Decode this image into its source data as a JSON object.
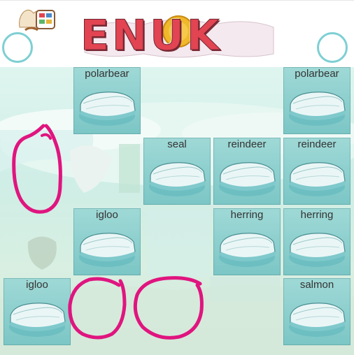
{
  "header": {
    "title": "ENUK",
    "logo_icon": "game-logo-icon",
    "left_circle": "circle-outline",
    "right_circle": "circle-outline"
  },
  "board": {
    "cards": [
      {
        "label": "polarbear",
        "icon": "ice-floe-icon"
      },
      {
        "label": "polarbear",
        "icon": "ice-floe-icon"
      },
      {
        "label": "seal",
        "icon": "ice-floe-icon"
      },
      {
        "label": "reindeer",
        "icon": "ice-floe-icon"
      },
      {
        "label": "reindeer",
        "icon": "ice-floe-icon"
      },
      {
        "label": "igloo",
        "icon": "ice-floe-icon"
      },
      {
        "label": "herring",
        "icon": "ice-floe-icon"
      },
      {
        "label": "herring",
        "icon": "ice-floe-icon"
      },
      {
        "label": "igloo",
        "icon": "ice-floe-icon"
      },
      {
        "label": "salmon",
        "icon": "ice-floe-icon"
      }
    ]
  },
  "colors": {
    "header_bg": "#ffffff",
    "circle": "#7ecfd3",
    "card": "#8fd0cf",
    "mark": "#e0157f",
    "title": "#e24452"
  }
}
